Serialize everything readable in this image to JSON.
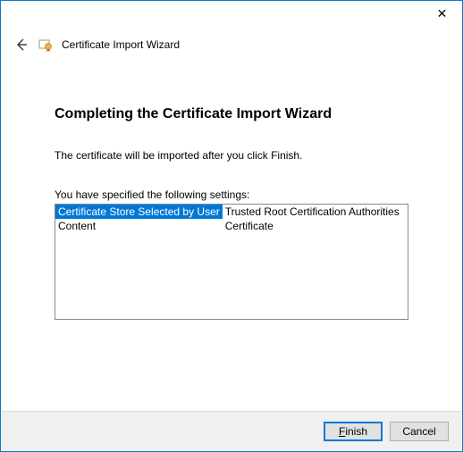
{
  "window": {
    "close_glyph": "✕"
  },
  "header": {
    "back_glyph": "←",
    "title": "Certificate Import Wizard"
  },
  "page": {
    "title": "Completing the Certificate Import Wizard",
    "info": "The certificate will be imported after you click Finish.",
    "settings_label": "You have specified the following settings:",
    "rows": [
      {
        "key": "Certificate Store Selected by User",
        "value": "Trusted Root Certification Authorities"
      },
      {
        "key": "Content",
        "value": "Certificate"
      }
    ]
  },
  "buttons": {
    "finish": "Finish",
    "cancel": "Cancel"
  }
}
